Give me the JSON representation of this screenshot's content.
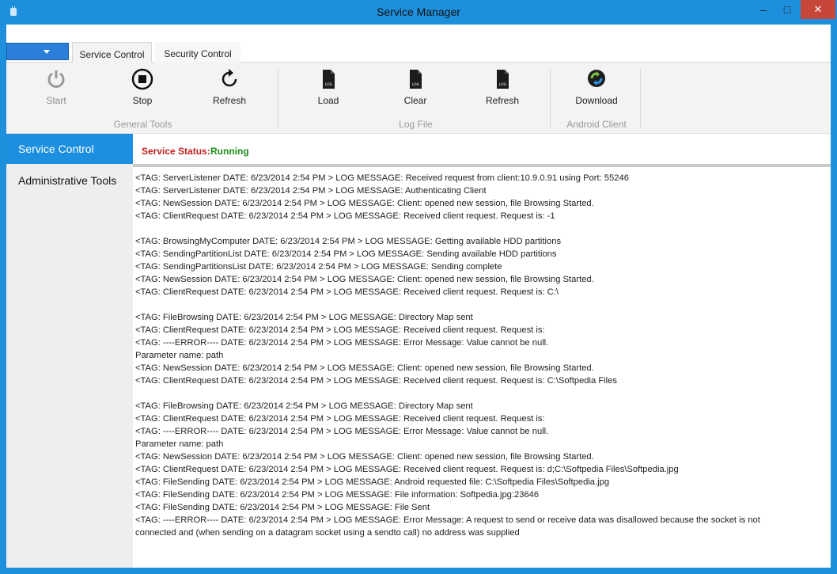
{
  "window": {
    "title": "Service Manager",
    "minimize_glyph": "–",
    "maximize_glyph": "□",
    "close_glyph": "✕"
  },
  "tabs": [
    {
      "label": "Service Control",
      "active": true
    },
    {
      "label": "Security Control",
      "active": false
    }
  ],
  "ribbon": {
    "general_tools": {
      "label": "General Tools",
      "start": "Start",
      "stop": "Stop",
      "refresh": "Refresh"
    },
    "log_file": {
      "label": "Log File",
      "load": "Load",
      "clear": "Clear",
      "refresh": "Refresh",
      "icon_text": "LOG"
    },
    "android_client": {
      "label": "Android Client",
      "download": "Download"
    }
  },
  "sidebar": {
    "items": [
      {
        "label": "Service Control",
        "active": true
      },
      {
        "label": "Administrative Tools",
        "active": false
      }
    ]
  },
  "status": {
    "label": "Service Status:",
    "value": "Running"
  },
  "log_lines": [
    "<TAG: ServerListener DATE: 6/23/2014 2:54 PM > LOG MESSAGE: Received request from client:10.9.0.91 using Port: 55246",
    "<TAG: ServerListener DATE: 6/23/2014 2:54 PM > LOG MESSAGE: Authenticating Client",
    "<TAG: NewSession DATE: 6/23/2014 2:54 PM > LOG MESSAGE: Client:  opened new session, file Browsing Started.",
    "<TAG: ClientRequest DATE: 6/23/2014 2:54 PM > LOG MESSAGE: Received client request. Request is: -1",
    "",
    "<TAG: BrowsingMyComputer DATE: 6/23/2014 2:54 PM > LOG MESSAGE: Getting available HDD partitions",
    "<TAG: SendingPartitionList DATE: 6/23/2014 2:54 PM > LOG MESSAGE: Sending available HDD partitions",
    "<TAG: SendingPartitionsList DATE: 6/23/2014 2:54 PM > LOG MESSAGE: Sending complete",
    "<TAG: NewSession DATE: 6/23/2014 2:54 PM > LOG MESSAGE: Client:  opened new session, file Browsing Started.",
    "<TAG: ClientRequest DATE: 6/23/2014 2:54 PM > LOG MESSAGE: Received client request. Request is: C:\\",
    "",
    "<TAG: FileBrowsing DATE: 6/23/2014 2:54 PM > LOG MESSAGE: Directory Map sent",
    "<TAG: ClientRequest DATE: 6/23/2014 2:54 PM > LOG MESSAGE: Received client request. Request is:",
    "<TAG: ----ERROR---- DATE: 6/23/2014 2:54 PM > LOG MESSAGE: Error Message: Value cannot be null.",
    "Parameter name: path",
    "<TAG: NewSession DATE: 6/23/2014 2:54 PM > LOG MESSAGE: Client:  opened new session, file Browsing Started.",
    "<TAG: ClientRequest DATE: 6/23/2014 2:54 PM > LOG MESSAGE: Received client request. Request is: C:\\Softpedia Files",
    "",
    "<TAG: FileBrowsing DATE: 6/23/2014 2:54 PM > LOG MESSAGE: Directory Map sent",
    "<TAG: ClientRequest DATE: 6/23/2014 2:54 PM > LOG MESSAGE: Received client request. Request is:",
    "<TAG: ----ERROR---- DATE: 6/23/2014 2:54 PM > LOG MESSAGE: Error Message: Value cannot be null.",
    "Parameter name: path",
    "<TAG: NewSession DATE: 6/23/2014 2:54 PM > LOG MESSAGE: Client:  opened new session, file Browsing Started.",
    "<TAG: ClientRequest DATE: 6/23/2014 2:54 PM > LOG MESSAGE: Received client request. Request is: d;C:\\Softpedia Files\\Softpedia.jpg",
    "<TAG: FileSending DATE: 6/23/2014 2:54 PM > LOG MESSAGE: Android requested file: C:\\Softpedia Files\\Softpedia.jpg",
    "<TAG: FileSending DATE: 6/23/2014 2:54 PM > LOG MESSAGE: File information: Softpedia.jpg:23646",
    "<TAG: FileSending DATE: 6/23/2014 2:54 PM > LOG MESSAGE: File Sent",
    "<TAG: ----ERROR---- DATE: 6/23/2014 2:54 PM > LOG MESSAGE: Error Message: A request to send or receive data was disallowed because the socket is not",
    "connected and (when sending on a datagram socket using a sendto call) no address was supplied"
  ],
  "colors": {
    "accent": "#1e8fdc",
    "status_label": "#c41f1f",
    "status_value": "#1a8f1a",
    "close_button": "#c7463a"
  }
}
